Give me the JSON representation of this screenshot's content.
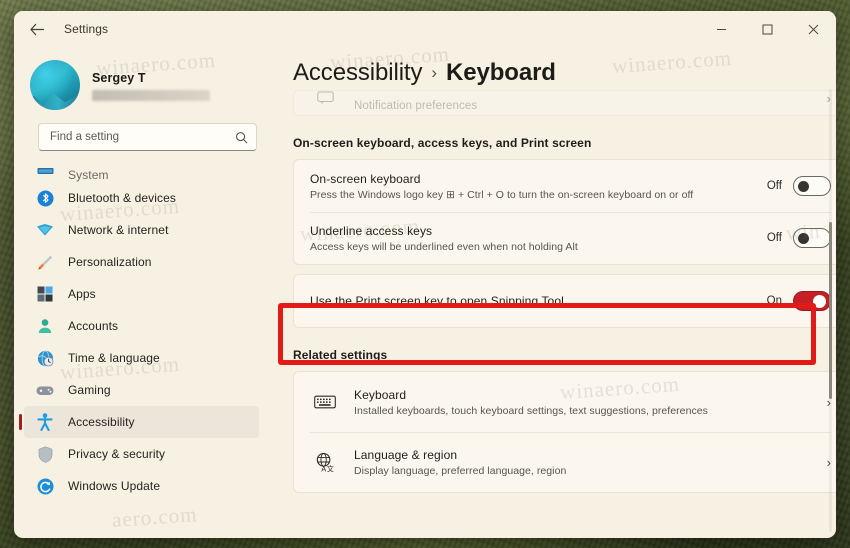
{
  "window": {
    "title": "Settings",
    "back_icon": "back-arrow-icon",
    "controls": {
      "minimize": "–",
      "maximize": "□",
      "close": "✕"
    }
  },
  "account": {
    "name": "Sergey T",
    "email_redacted": ""
  },
  "search": {
    "placeholder": "Find a setting",
    "value": "",
    "icon": "search-icon"
  },
  "sidebar": {
    "items": [
      {
        "label": "System",
        "icon": "system-icon",
        "selected": false,
        "partial": true
      },
      {
        "label": "Bluetooth & devices",
        "icon": "bluetooth-icon",
        "selected": false,
        "partial": false
      },
      {
        "label": "Network & internet",
        "icon": "network-icon",
        "selected": false,
        "partial": false
      },
      {
        "label": "Personalization",
        "icon": "paintbrush-icon",
        "selected": false,
        "partial": false
      },
      {
        "label": "Apps",
        "icon": "apps-icon",
        "selected": false,
        "partial": false
      },
      {
        "label": "Accounts",
        "icon": "account-icon",
        "selected": false,
        "partial": false
      },
      {
        "label": "Time & language",
        "icon": "time-language-icon",
        "selected": false,
        "partial": false
      },
      {
        "label": "Gaming",
        "icon": "gamepad-icon",
        "selected": false,
        "partial": false
      },
      {
        "label": "Accessibility",
        "icon": "accessibility-icon",
        "selected": true,
        "partial": false
      },
      {
        "label": "Privacy & security",
        "icon": "shield-icon",
        "selected": false,
        "partial": false
      },
      {
        "label": "Windows Update",
        "icon": "windows-update-icon",
        "selected": false,
        "partial": false
      }
    ]
  },
  "main": {
    "breadcrumb": {
      "parent": "Accessibility",
      "separator": "›",
      "current": "Keyboard"
    },
    "clipped_row": {
      "title": "Notification preferences",
      "icon": "notification-icon",
      "chevron": "›"
    },
    "section_heading": "On-screen keyboard, access keys, and Print screen",
    "settings_rows": [
      {
        "title": "On-screen keyboard",
        "subtitle": "Press the Windows logo key ⊞ + Ctrl + O to turn the on-screen keyboard on or off",
        "state_label": "Off",
        "state_on": false
      },
      {
        "title": "Underline access keys",
        "subtitle": "Access keys will be underlined even when not holding Alt",
        "state_label": "Off",
        "state_on": false
      }
    ],
    "highlighted_row": {
      "title": "Use the Print screen key to open Snipping Tool",
      "subtitle": "",
      "state_label": "On",
      "state_on": true
    },
    "related_heading": "Related settings",
    "related_items": [
      {
        "title": "Keyboard",
        "subtitle": "Installed keyboards, touch keyboard settings, text suggestions, preferences",
        "icon": "keyboard-icon",
        "chevron": "›"
      },
      {
        "title": "Language & region",
        "subtitle": "Display language, preferred language, region",
        "icon": "language-region-icon",
        "chevron": "›"
      }
    ]
  },
  "annotation": {
    "color": "#e31b18",
    "target": "Use the Print screen key to open Snipping Tool"
  },
  "colors": {
    "accent": "#c42026",
    "window_bg": "#f7f1e4",
    "card_bg": "#fbf7ee",
    "text": "#1f1e1a"
  },
  "watermarks": [
    "winaero.com",
    "winaero.com",
    "winaero.com",
    "winaero.com",
    "winaero.com",
    "win",
    "winaero.com",
    "winaero.com",
    "aero.com"
  ]
}
